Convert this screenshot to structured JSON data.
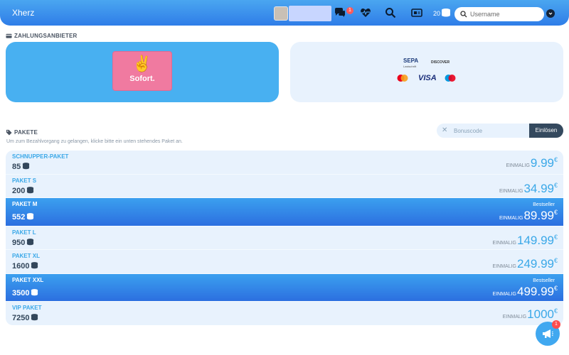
{
  "header": {
    "brand": "Xherz",
    "message_badge": "1",
    "coins": "20",
    "search_placeholder": "Username"
  },
  "payment": {
    "title": "ZAHLUNGSANBIETER",
    "sofort_label": "Sofort.",
    "sepa_label": "SEPA",
    "sepa_sub": "Lastschrift",
    "discover_label": "DISCOVER",
    "visa_label": "VISA"
  },
  "packages_section": {
    "title": "PAKETE",
    "subtitle": "Um zum Bezahlvorgang zu gelangen, klicke bitte ein unten stehendes Paket an.",
    "bonus_placeholder": "Bonuscode",
    "bonus_button": "Einlösen",
    "price_prefix": "EINMALIG",
    "currency": "€",
    "bestseller_label": "Bestseller"
  },
  "packages": [
    {
      "name": "SCHNUPPER-PAKET",
      "amount": "85",
      "price": "9.99",
      "featured": false
    },
    {
      "name": "PAKET S",
      "amount": "200",
      "price": "34.99",
      "featured": false
    },
    {
      "name": "PAKET M",
      "amount": "552",
      "price": "89.99",
      "featured": true
    },
    {
      "name": "PAKET L",
      "amount": "950",
      "price": "149.99",
      "featured": false
    },
    {
      "name": "PAKET XL",
      "amount": "1600",
      "price": "249.99",
      "featured": false
    },
    {
      "name": "PAKET XXL",
      "amount": "3500",
      "price": "499.99",
      "featured": true
    },
    {
      "name": "VIP PAKET",
      "amount": "7250",
      "price": "1000",
      "featured": false
    }
  ],
  "fab": {
    "badge": "1"
  },
  "colors": {
    "header": "#2f7de8",
    "accent": "#3aa8e8",
    "featured": "#2c6fe0",
    "sofort": "#f07aa0"
  }
}
